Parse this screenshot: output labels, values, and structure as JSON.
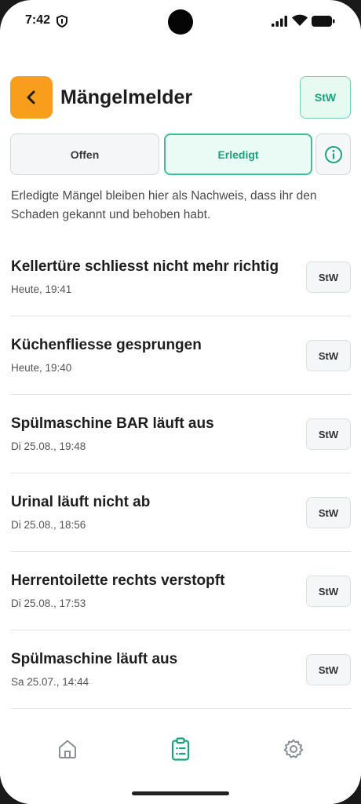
{
  "status_bar": {
    "time": "7:42"
  },
  "header": {
    "back_icon": "chevron-left-icon",
    "title": "Mängelmelder",
    "user_badge": "StW"
  },
  "tabs": {
    "open_label": "Offen",
    "done_label": "Erledigt",
    "active": "Erledigt",
    "info_icon": "info-icon"
  },
  "description": "Erledigte Mängel bleiben hier als Nachweis, dass ihr den Schaden gekannt und behoben habt.",
  "items": [
    {
      "title": "Kellertüre  schliesst nicht mehr richtig",
      "time": "Heute, 19:41",
      "badge": "StW"
    },
    {
      "title": "Küchenfliesse gesprungen",
      "time": "Heute, 19:40",
      "badge": "StW"
    },
    {
      "title": "Spülmaschine BAR läuft aus",
      "time": "Di 25.08., 19:48",
      "badge": "StW"
    },
    {
      "title": "Urinal läuft nicht ab",
      "time": "Di 25.08., 18:56",
      "badge": "StW"
    },
    {
      "title": "Herrentoilette rechts verstopft",
      "time": "Di 25.08., 17:53",
      "badge": "StW"
    },
    {
      "title": "Spülmaschine läuft aus",
      "time": "Sa 25.07., 14:44",
      "badge": "StW"
    }
  ],
  "navbar": {
    "items": [
      "home-icon",
      "clipboard-list-icon",
      "gear-icon"
    ],
    "active": "clipboard-list-icon"
  },
  "colors": {
    "accent_orange": "#f99d1c",
    "accent_green": "#18a37a",
    "green_bg": "#e9fbf4"
  }
}
